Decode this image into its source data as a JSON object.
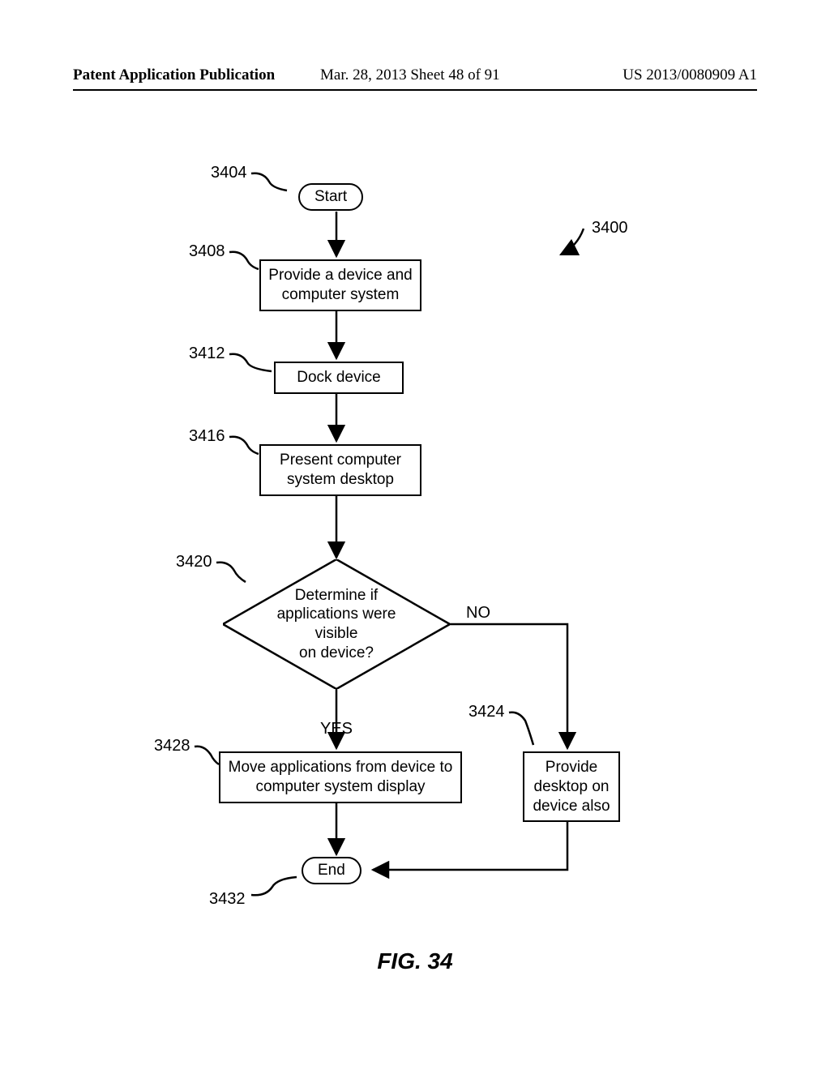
{
  "header": {
    "left": "Patent Application Publication",
    "center": "Mar. 28, 2013  Sheet 48 of 91",
    "right": "US 2013/0080909 A1"
  },
  "figure": {
    "caption": "FIG. 34",
    "overall_ref": "3400"
  },
  "nodes": {
    "start": {
      "ref": "3404",
      "text": "Start"
    },
    "provide": {
      "ref": "3408",
      "text_l1": "Provide a device and",
      "text_l2": "computer system"
    },
    "dock": {
      "ref": "3412",
      "text": "Dock device"
    },
    "present": {
      "ref": "3416",
      "text_l1": "Present computer",
      "text_l2": "system desktop"
    },
    "decision": {
      "ref": "3420",
      "text_l1": "Determine if",
      "text_l2": "applications were visible",
      "text_l3": "on device?"
    },
    "move": {
      "ref": "3428",
      "text_l1": "Move applications from device to",
      "text_l2": "computer system display"
    },
    "desktop_also": {
      "ref": "3424",
      "text_l1": "Provide",
      "text_l2": "desktop on",
      "text_l3": "device also"
    },
    "end": {
      "ref": "3432",
      "text": "End"
    }
  },
  "edges": {
    "yes": "YES",
    "no": "NO"
  }
}
